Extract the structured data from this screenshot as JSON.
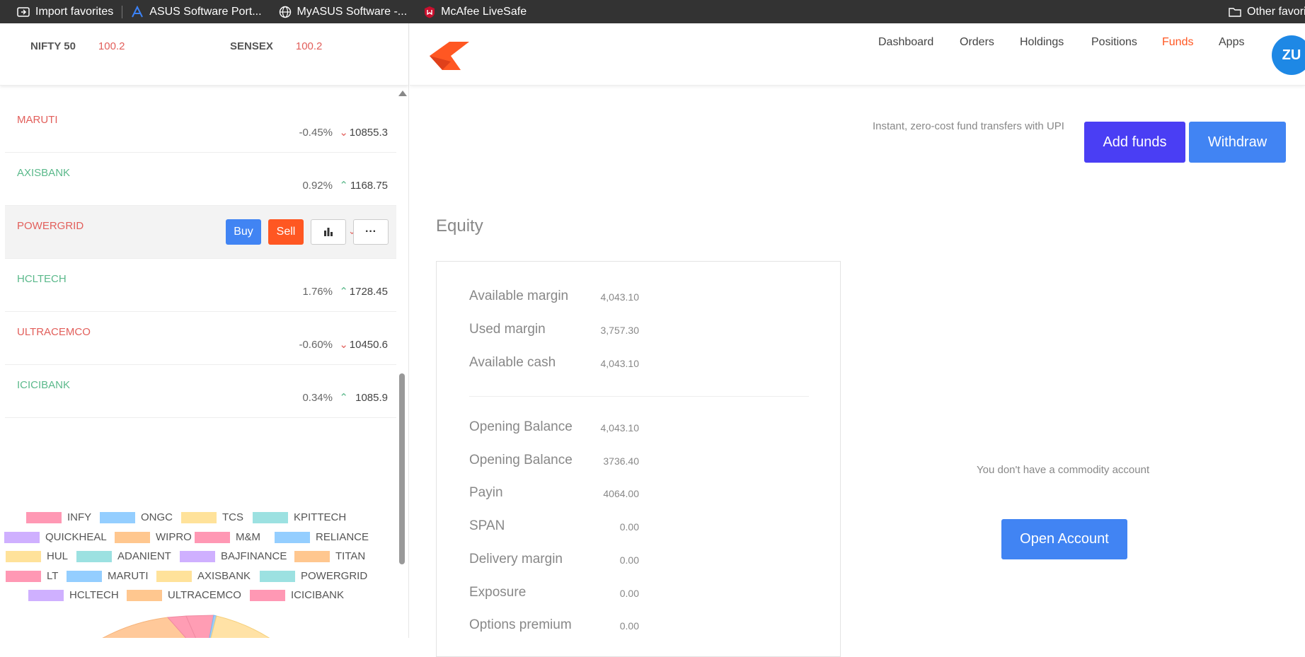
{
  "bookmarks": {
    "items": [
      {
        "label": "Import favorites"
      },
      {
        "label": "ASUS Software Port..."
      },
      {
        "label": "MyASUS Software -..."
      },
      {
        "label": "McAfee LiveSafe"
      }
    ],
    "other_label": "Other favorites"
  },
  "indices": [
    {
      "name": "NIFTY 50",
      "value": "100.2"
    },
    {
      "name": "SENSEX",
      "value": "100.2"
    }
  ],
  "watchlist": [
    {
      "symbol": "MARUTI",
      "change": "-0.45%",
      "price": "10855.3",
      "direction": "down"
    },
    {
      "symbol": "AXISBANK",
      "change": "0.92%",
      "price": "1168.75",
      "direction": "up"
    },
    {
      "symbol": "POWERGRID",
      "change": "",
      "price": "",
      "direction": "down",
      "hovered": true
    },
    {
      "symbol": "HCLTECH",
      "change": "1.76%",
      "price": "1728.45",
      "direction": "up"
    },
    {
      "symbol": "ULTRACEMCO",
      "change": "-0.60%",
      "price": "10450.6",
      "direction": "down"
    },
    {
      "symbol": "ICICIBANK",
      "change": "0.34%",
      "price": "1085.9",
      "direction": "up"
    }
  ],
  "row_actions": {
    "buy": "Buy",
    "sell": "Sell",
    "more": "···"
  },
  "legend": [
    {
      "label": "INFY",
      "color": "#ff9db4"
    },
    {
      "label": "ONGC",
      "color": "#9ccdf7"
    },
    {
      "label": "TCS",
      "color": "#ffe2a6"
    },
    {
      "label": "KPITTECH",
      "color": "#a5dfdf"
    },
    {
      "label": "QUICKHEAL",
      "color": "#ccb2ff"
    },
    {
      "label": "WIPRO",
      "color": "#ffc99a"
    },
    {
      "label": "M&M",
      "color": "#ff9db4"
    },
    {
      "label": "RELIANCE",
      "color": "#9ccdf7"
    },
    {
      "label": "HUL",
      "color": "#ffe2a6"
    },
    {
      "label": "ADANIENT",
      "color": "#a5dfdf"
    },
    {
      "label": "BAJFINANCE",
      "color": "#ccb2ff"
    },
    {
      "label": "TITAN",
      "color": "#ffc99a"
    },
    {
      "label": "LT",
      "color": "#ff9db4"
    },
    {
      "label": "MARUTI",
      "color": "#9ccdf7"
    },
    {
      "label": "AXISBANK",
      "color": "#ffe2a6"
    },
    {
      "label": "POWERGRID",
      "color": "#a5dfdf"
    },
    {
      "label": "HCLTECH",
      "color": "#ccb2ff"
    },
    {
      "label": "ULTRACEMCO",
      "color": "#ffc99a"
    },
    {
      "label": "ICICIBANK",
      "color": "#ff9db4"
    }
  ],
  "nav": {
    "items": [
      "Dashboard",
      "Orders",
      "Holdings",
      "Positions",
      "Funds",
      "Apps"
    ],
    "active": "Funds",
    "avatar": "ZU"
  },
  "funds": {
    "upi_text": "Instant, zero-cost fund transfers with UPI",
    "add_funds": "Add funds",
    "withdraw": "Withdraw"
  },
  "equity": {
    "title": "Equity",
    "rows_top": [
      {
        "label": "Available margin",
        "value": "4,043.10"
      },
      {
        "label": "Used margin",
        "value": "3,757.30"
      },
      {
        "label": "Available cash",
        "value": "4,043.10"
      }
    ],
    "rows_bottom": [
      {
        "label": "Opening Balance",
        "value": "4,043.10"
      },
      {
        "label": "Opening Balance",
        "value": "3736.40"
      },
      {
        "label": "Payin",
        "value": "4064.00"
      },
      {
        "label": "SPAN",
        "value": "0.00"
      },
      {
        "label": "Delivery margin",
        "value": "0.00"
      },
      {
        "label": "Exposure",
        "value": "0.00"
      },
      {
        "label": "Options premium",
        "value": "0.00"
      }
    ]
  },
  "commodity": {
    "message": "You don't have a commodity account",
    "open_account": "Open Account"
  }
}
